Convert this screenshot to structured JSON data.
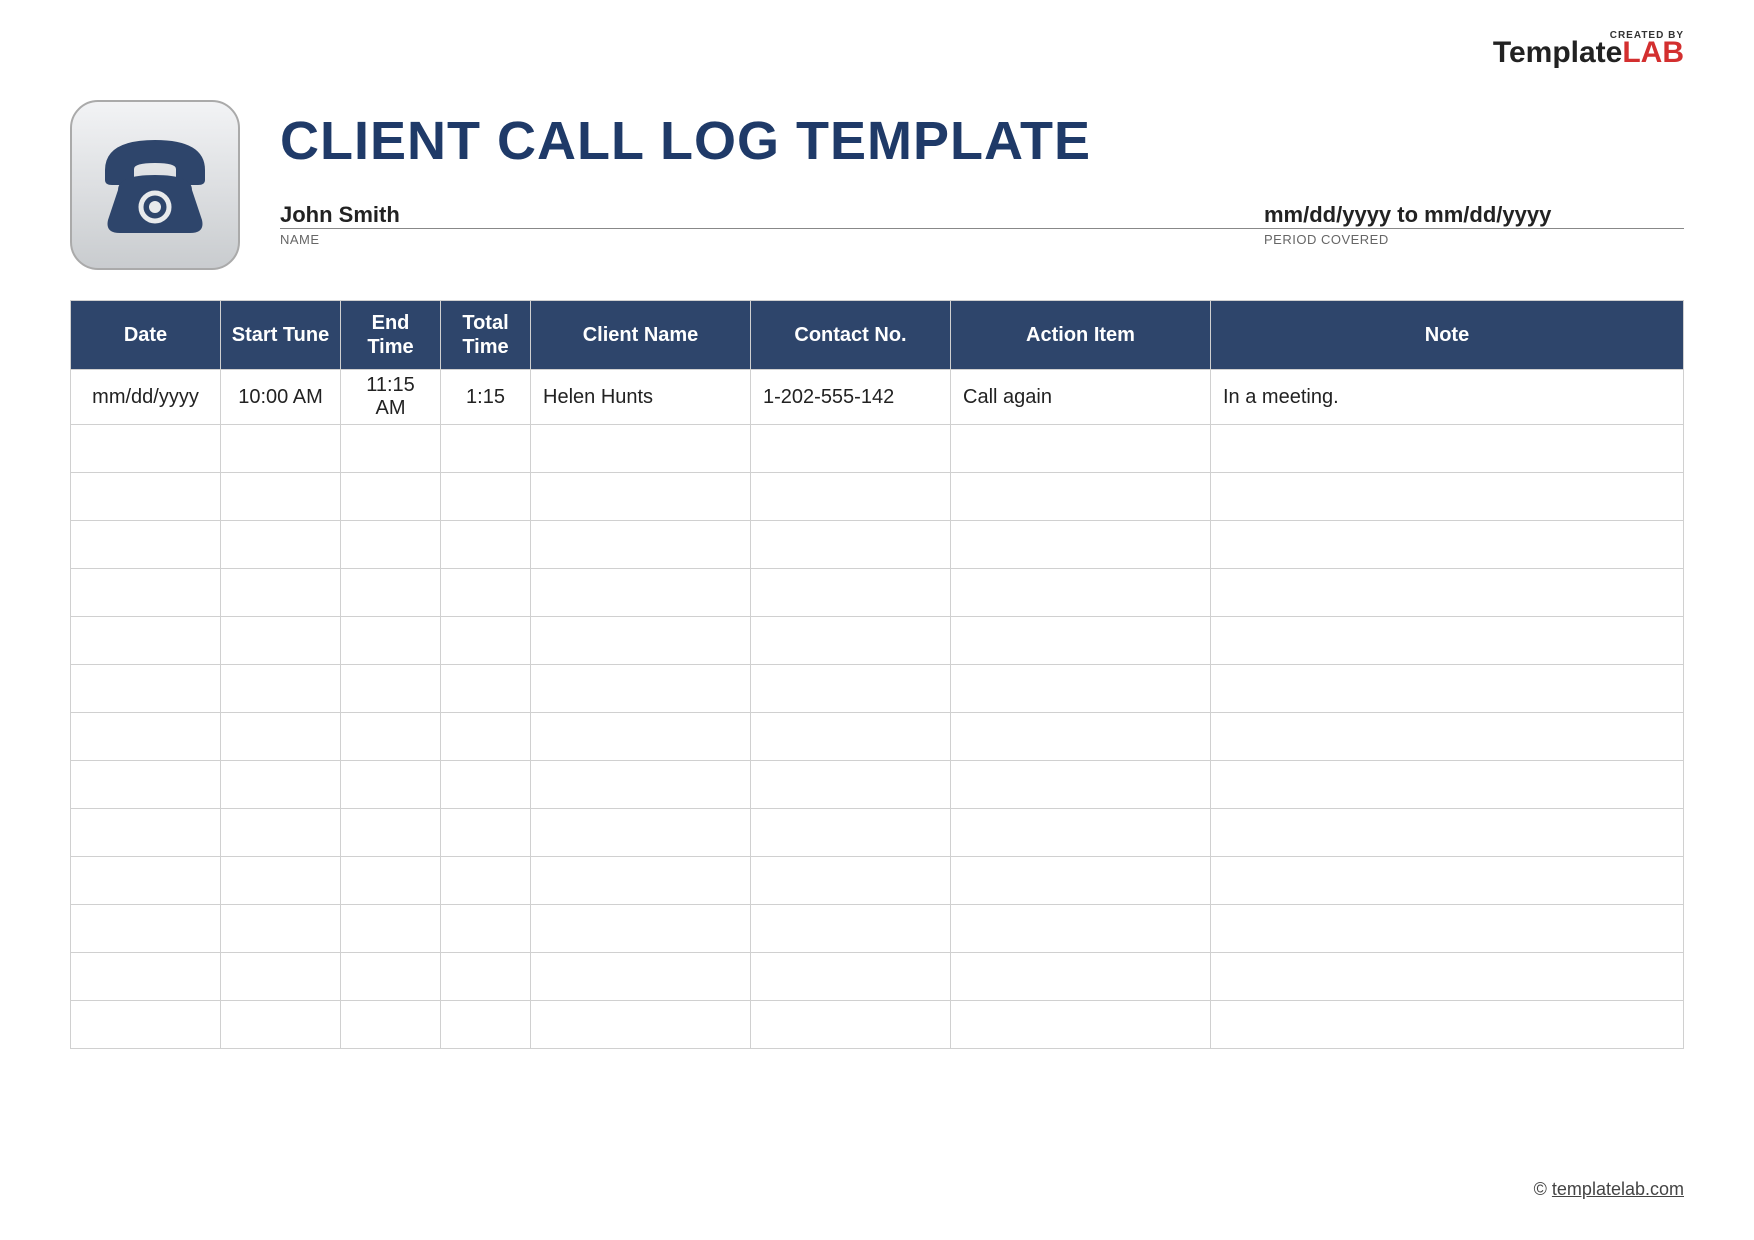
{
  "brand": {
    "created_by": "CREATED BY",
    "name1": "Template",
    "name2": "LAB"
  },
  "header": {
    "title": "CLIENT CALL LOG TEMPLATE",
    "name_value": "John Smith",
    "name_label": "NAME",
    "period_value": "mm/dd/yyyy to mm/dd/yyyy",
    "period_label": "PERIOD COVERED"
  },
  "table": {
    "headers": [
      "Date",
      "Start Tune",
      "End Time",
      "Total Time",
      "Client Name",
      "Contact No.",
      "Action Item",
      "Note"
    ],
    "rows": [
      {
        "date": "mm/dd/yyyy",
        "start": "10:00 AM",
        "end": "11:15 AM",
        "total": "1:15",
        "client": "Helen Hunts",
        "contact": "1-202-555-142",
        "action": "Call again",
        "note": "In a meeting."
      },
      {
        "date": "",
        "start": "",
        "end": "",
        "total": "",
        "client": "",
        "contact": "",
        "action": "",
        "note": ""
      },
      {
        "date": "",
        "start": "",
        "end": "",
        "total": "",
        "client": "",
        "contact": "",
        "action": "",
        "note": ""
      },
      {
        "date": "",
        "start": "",
        "end": "",
        "total": "",
        "client": "",
        "contact": "",
        "action": "",
        "note": ""
      },
      {
        "date": "",
        "start": "",
        "end": "",
        "total": "",
        "client": "",
        "contact": "",
        "action": "",
        "note": ""
      },
      {
        "date": "",
        "start": "",
        "end": "",
        "total": "",
        "client": "",
        "contact": "",
        "action": "",
        "note": ""
      },
      {
        "date": "",
        "start": "",
        "end": "",
        "total": "",
        "client": "",
        "contact": "",
        "action": "",
        "note": ""
      },
      {
        "date": "",
        "start": "",
        "end": "",
        "total": "",
        "client": "",
        "contact": "",
        "action": "",
        "note": ""
      },
      {
        "date": "",
        "start": "",
        "end": "",
        "total": "",
        "client": "",
        "contact": "",
        "action": "",
        "note": ""
      },
      {
        "date": "",
        "start": "",
        "end": "",
        "total": "",
        "client": "",
        "contact": "",
        "action": "",
        "note": ""
      },
      {
        "date": "",
        "start": "",
        "end": "",
        "total": "",
        "client": "",
        "contact": "",
        "action": "",
        "note": ""
      },
      {
        "date": "",
        "start": "",
        "end": "",
        "total": "",
        "client": "",
        "contact": "",
        "action": "",
        "note": ""
      },
      {
        "date": "",
        "start": "",
        "end": "",
        "total": "",
        "client": "",
        "contact": "",
        "action": "",
        "note": ""
      },
      {
        "date": "",
        "start": "",
        "end": "",
        "total": "",
        "client": "",
        "contact": "",
        "action": "",
        "note": ""
      }
    ]
  },
  "footer": {
    "copyright": "©",
    "link": "templatelab.com"
  }
}
